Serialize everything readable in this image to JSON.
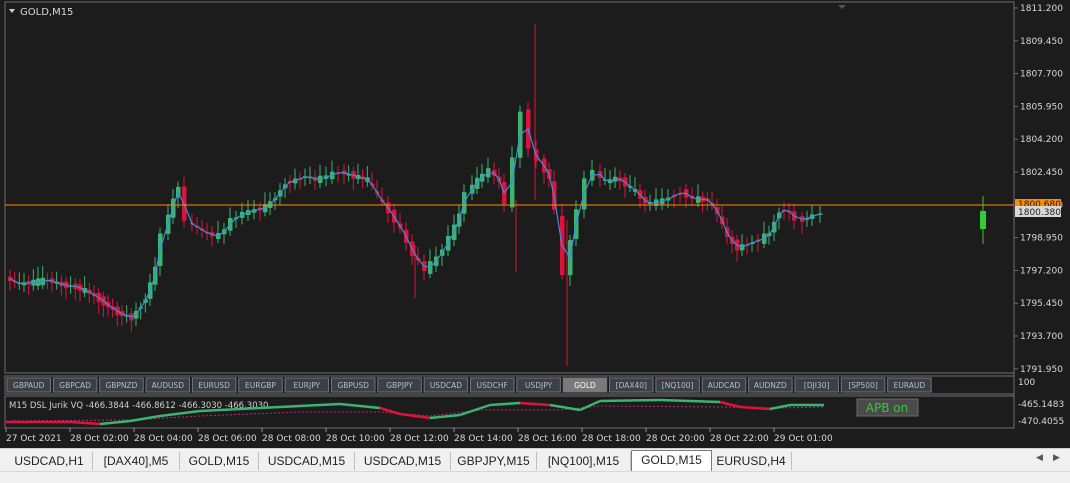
{
  "chart_title": "GOLD,M15",
  "price_axis": [
    "1811.200",
    "1809.450",
    "1807.700",
    "1805.950",
    "1804.200",
    "1802.450",
    "1800.700",
    "1798.950",
    "1797.200",
    "1795.450",
    "1793.700",
    "1791.950"
  ],
  "price_labels": {
    "ask": "1800.680",
    "bid": "1800.380"
  },
  "symbol_buttons": [
    "GBPAUD",
    "GBPCAD",
    "GBPNZD",
    "AUDUSD",
    "EURUSD",
    "EURGBP",
    "EURJPY",
    "GBPUSD",
    "GBPJPY",
    "USDCAD",
    "USDCHF",
    "USDJPY",
    "GOLD",
    "[DAX40]",
    "[NQ100]",
    "AUDCAD",
    "AUDNZD",
    "[DJI30]",
    "[SP500]",
    "EURAUD"
  ],
  "active_symbol": "GOLD",
  "indicator": {
    "label": "M15 DSL Jurik VQ -466.3844 -466.8612 -466.3030 -466.3030",
    "axis_top": "100",
    "axis": [
      "-465.1483",
      "-470.4055"
    ],
    "apb_button": "APB on"
  },
  "time_axis": [
    "27 Oct 2021",
    "28 Oct 02:00",
    "28 Oct 04:00",
    "28 Oct 06:00",
    "28 Oct 08:00",
    "28 Oct 10:00",
    "28 Oct 12:00",
    "28 Oct 14:00",
    "28 Oct 16:00",
    "28 Oct 18:00",
    "28 Oct 20:00",
    "28 Oct 22:00",
    "29 Oct 01:00"
  ],
  "tabs": [
    "USDCAD,H1",
    "[DAX40],M5",
    "GOLD,M15",
    "USDCAD,M15",
    "USDCAD,M15",
    "GBPJPY,M15",
    "[NQ100],M15",
    "GOLD,M15",
    "EURUSD,H4"
  ],
  "active_tab_index": 7,
  "colors": {
    "bull": "#3cb371",
    "bear": "#dc143c",
    "line": "#3b8ede",
    "price_line": "#ff8c00",
    "background": "#1c1c1c"
  }
}
